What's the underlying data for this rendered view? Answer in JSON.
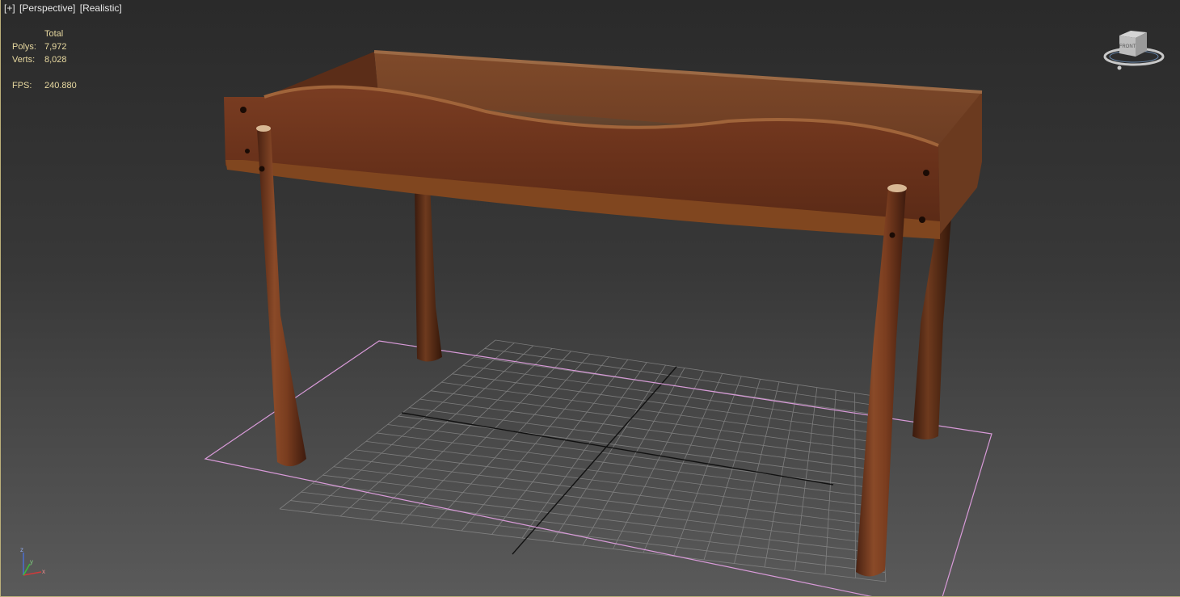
{
  "viewport": {
    "labels": [
      "[+]",
      "[Perspective]",
      "[Realistic]"
    ]
  },
  "statistics": {
    "header": "Total",
    "polys_label": "Polys:",
    "polys_value": "7,972",
    "verts_label": "Verts:",
    "verts_value": "8,028",
    "fps_label": "FPS:",
    "fps_value": "240.880"
  },
  "viewcube": {
    "face_label": "FRONT"
  },
  "axis_tripod": {
    "z": "z",
    "y": "y",
    "x": "x"
  },
  "colors": {
    "stats_text": "#e8d9a0",
    "grid_line": "#9a9a9a",
    "grid_axis": "#101010",
    "selection_box": "#d79ad7",
    "wood_dark": "#5a2a16",
    "wood_mid": "#7a3d20",
    "wood_light": "#9a5a34"
  }
}
